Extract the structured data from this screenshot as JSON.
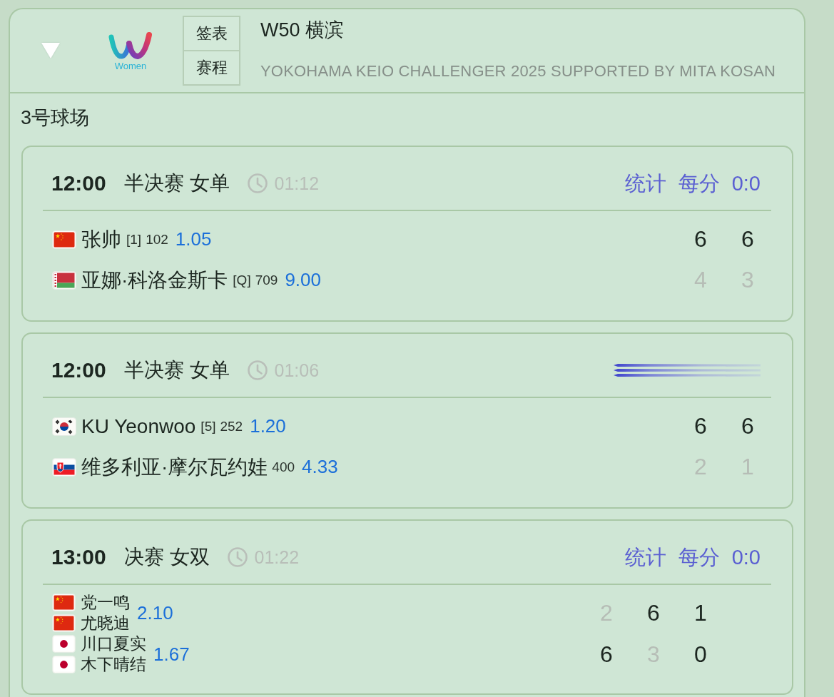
{
  "panel": {
    "expanded": true,
    "logo": {
      "caption": "Women"
    },
    "tabs": [
      {
        "label": "签表"
      },
      {
        "label": "赛程"
      }
    ],
    "title": "W50 横滨",
    "subtitle": "YOKOHAMA KEIO CHALLENGER 2025 SUPPORTED BY MITA KOSAN"
  },
  "court": {
    "name": "3号球场"
  },
  "matches": [
    {
      "kind": "singles",
      "time": "12:00",
      "round": "半决赛 女单",
      "duration": "01:12",
      "header_right": {
        "kind": "links",
        "links": [
          "统计",
          "每分",
          "0:0"
        ]
      },
      "sides": [
        {
          "odds": "1.05",
          "players": [
            {
              "kind": "china",
              "name": "张帅",
              "seed": "[1]",
              "rank": "102"
            }
          ],
          "scores": [
            {
              "value": "6",
              "lost": false
            },
            {
              "value": "6",
              "lost": false
            }
          ]
        },
        {
          "odds": "9.00",
          "players": [
            {
              "kind": "belarus",
              "name": "亚娜·科洛金斯卡",
              "seed": "[Q]",
              "rank": "709"
            }
          ],
          "scores": [
            {
              "value": "4",
              "lost": true
            },
            {
              "value": "3",
              "lost": true
            }
          ]
        }
      ]
    },
    {
      "kind": "singles",
      "time": "12:00",
      "round": "半决赛 女单",
      "duration": "01:06",
      "header_right": {
        "kind": "blurred"
      },
      "sides": [
        {
          "odds": "1.20",
          "players": [
            {
              "kind": "korea",
              "name": "KU Yeonwoo",
              "seed": "[5]",
              "rank": "252"
            }
          ],
          "scores": [
            {
              "value": "6",
              "lost": false
            },
            {
              "value": "6",
              "lost": false
            }
          ]
        },
        {
          "odds": "4.33",
          "players": [
            {
              "kind": "slovakia",
              "name": "维多利亚·摩尔瓦约娃",
              "rank": "400"
            }
          ],
          "scores": [
            {
              "value": "2",
              "lost": true
            },
            {
              "value": "1",
              "lost": true
            }
          ]
        }
      ]
    },
    {
      "kind": "doubles",
      "time": "13:00",
      "round": "决赛 女双",
      "duration": "01:22",
      "header_right": {
        "kind": "links",
        "links": [
          "统计",
          "每分",
          "0:0"
        ]
      },
      "sides": [
        {
          "odds": "2.10",
          "players": [
            {
              "kind": "china",
              "name": "党一鸣"
            },
            {
              "kind": "china",
              "name": "尤晓迪"
            }
          ],
          "scores": [
            {
              "value": "2",
              "lost": true
            },
            {
              "value": "6",
              "lost": false
            },
            {
              "value": "1",
              "lost": false
            }
          ]
        },
        {
          "odds": "1.67",
          "players": [
            {
              "kind": "japan",
              "name": "川口夏实"
            },
            {
              "kind": "japan",
              "name": "木下晴结"
            }
          ],
          "scores": [
            {
              "value": "6",
              "lost": false
            },
            {
              "value": "3",
              "lost": true
            },
            {
              "value": "0",
              "lost": false
            }
          ]
        }
      ]
    }
  ]
}
